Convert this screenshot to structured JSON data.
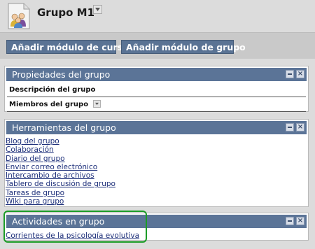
{
  "header": {
    "title": "Grupo M1",
    "group_icon": "group-people-icon",
    "menu_icon": "dropdown-menu-icon"
  },
  "actions": {
    "add_course_module": "Añadir módulo de curso",
    "add_group_module": "Añadir módulo de grupo"
  },
  "panels": {
    "properties": {
      "title": "Propiedades del grupo",
      "rows": [
        "Descripción del grupo",
        "Miembros del grupo"
      ]
    },
    "tools": {
      "title": "Herramientas del grupo",
      "links": [
        "Blog del grupo",
        "Colaboración",
        "Diario del grupo",
        "Enviar correo electrónico",
        "Intercambio de archivos",
        "Tablero de discusión de grupo",
        "Tareas de grupo",
        "Wiki para grupo"
      ]
    },
    "activities": {
      "title": "Actividades en grupo",
      "links": [
        "Corrientes de la psicología evolutiva"
      ]
    }
  },
  "colors": {
    "panel_header": "#5b7497",
    "button": "#5a7394",
    "highlight": "#1c9c27",
    "link": "#1d2f7a"
  }
}
